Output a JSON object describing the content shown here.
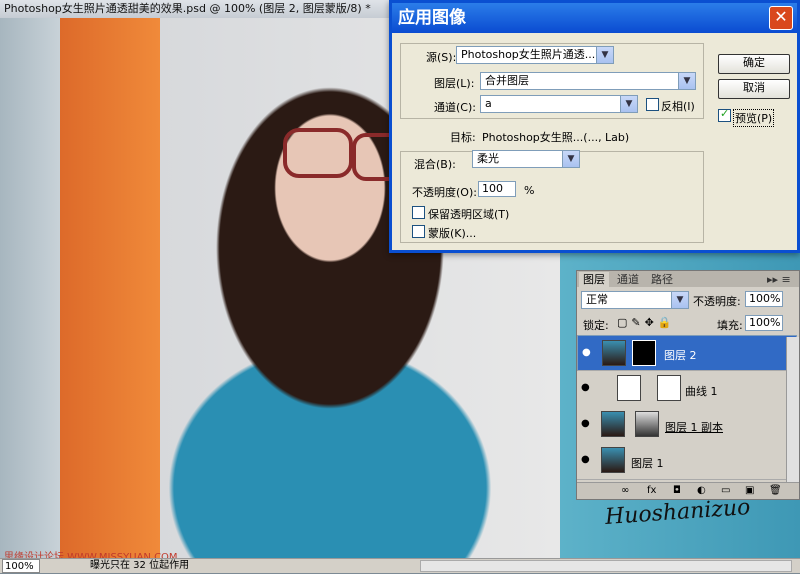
{
  "document": {
    "title": "Photoshop女生照片通透甜美的效果.psd @ 100% (图层 2, 图层蒙版/8) *"
  },
  "status_bar": {
    "zoom": "100%",
    "info": "曝光只在 32 位起作用"
  },
  "watermark": "思缘设计论坛 WWW.MISSYUAN.COM",
  "signature": "Huoshanizuo",
  "dialog": {
    "title": "应用图像",
    "close_label": "✕",
    "source_label": "源(S):",
    "source_value": "Photoshop女生照片通透...",
    "layer_label": "图层(L):",
    "layer_value": "合并图层",
    "channel_label": "通道(C):",
    "channel_value": "a",
    "invert_label": "反相(I)",
    "target_label": "目标:",
    "target_value": "Photoshop女生照...(..., Lab)",
    "blending_label": "混合(B):",
    "blending_value": "柔光",
    "opacity_label": "不透明度(O):",
    "opacity_value": "100",
    "opacity_unit": "%",
    "preserve_transparency_label": "保留透明区域(T)",
    "mask_label": "蒙版(K)...",
    "ok_label": "确定",
    "cancel_label": "取消",
    "preview_label": "预览(P)",
    "preview_checked": true
  },
  "layers_panel": {
    "tabs": [
      "图层",
      "通道",
      "路径"
    ],
    "blend_mode": "正常",
    "opacity_label": "不透明度:",
    "opacity_value": "100%",
    "lock_label": "锁定:",
    "fill_label": "填充:",
    "fill_value": "100%",
    "layers": [
      {
        "name": "图层 2",
        "selected": true
      },
      {
        "name": "曲线 1",
        "selected": false
      },
      {
        "name": "图层 1 副本",
        "selected": false
      },
      {
        "name": "图层 1",
        "selected": false
      }
    ],
    "footer_icons": [
      "link-icon",
      "fx-icon",
      "mask-icon",
      "adjustment-icon",
      "folder-icon",
      "new-layer-icon",
      "trash-icon"
    ]
  }
}
